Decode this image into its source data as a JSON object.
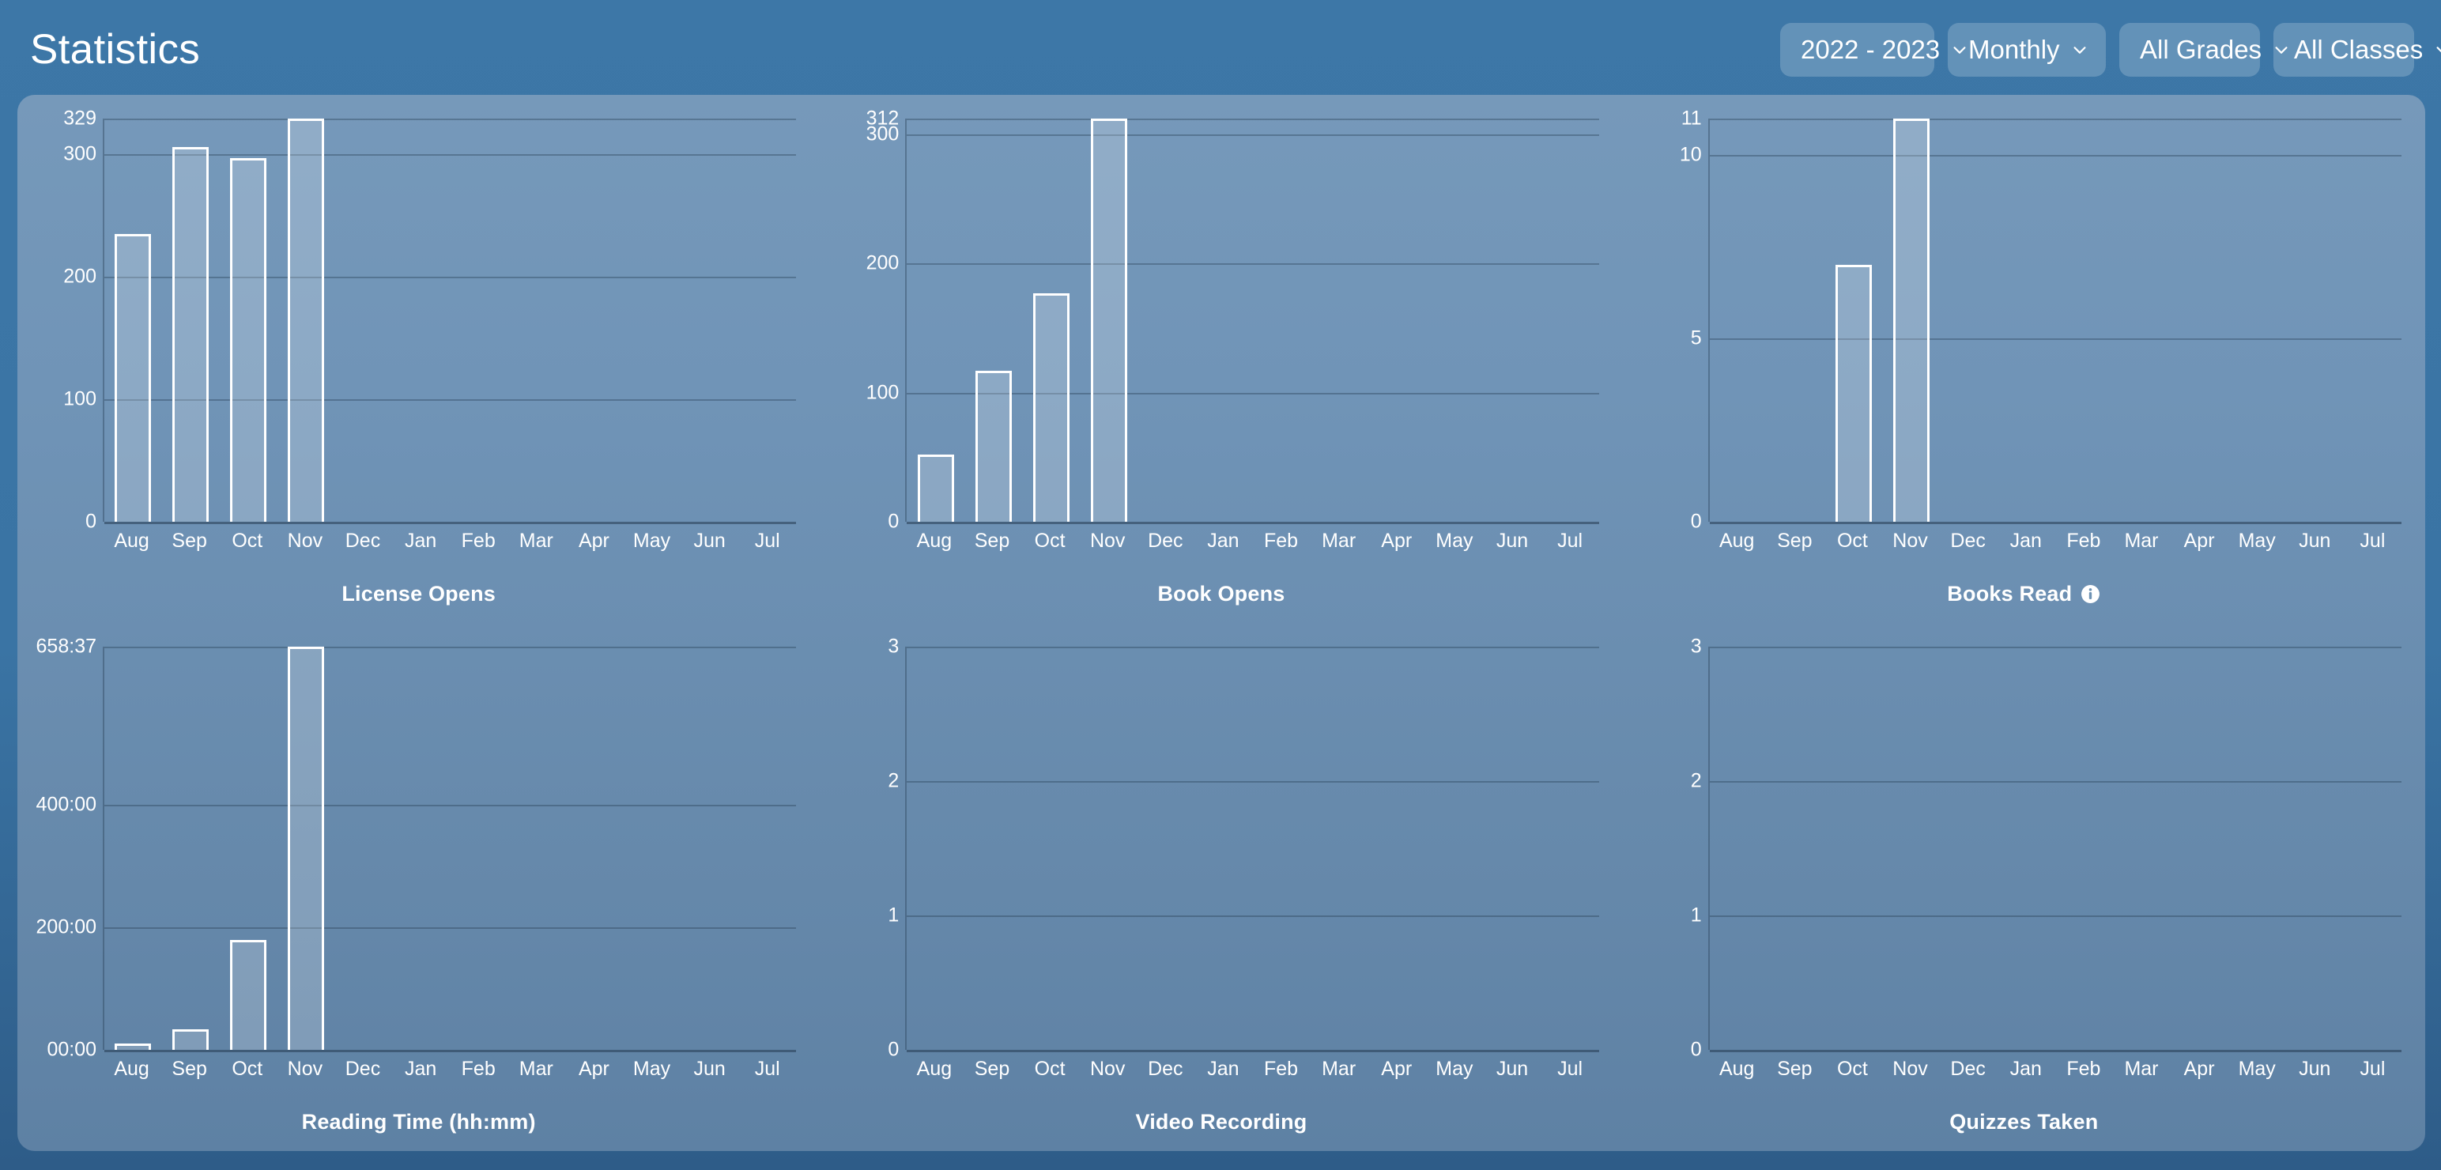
{
  "header": {
    "title": "Statistics",
    "controls": [
      {
        "name": "school-year",
        "label": "2022 - 2023",
        "icon": "chevron-down-icon"
      },
      {
        "name": "period",
        "label": "Monthly",
        "icon": "chevron-down-icon"
      },
      {
        "name": "grades",
        "label": "All Grades",
        "icon": "chevron-down-icon"
      },
      {
        "name": "classes",
        "label": "All Classes",
        "icon": "chevron-down-icon"
      }
    ]
  },
  "colors": {
    "page_background": "#3a74a4",
    "panel_background": "#6e92b4",
    "accent_text": "#ffffff",
    "bar_stroke": "#ffffff",
    "bar_fill": "#80a2c2",
    "gridline": "#3e5c78"
  },
  "months": [
    "Aug",
    "Sep",
    "Oct",
    "Nov",
    "Dec",
    "Jan",
    "Feb",
    "Mar",
    "Apr",
    "May",
    "Jun",
    "Jul"
  ],
  "chart_data": [
    {
      "type": "bar",
      "title": "License Opens",
      "has_info_icon": false,
      "xlabel": "",
      "ylabel": "",
      "categories": [
        "Aug",
        "Sep",
        "Oct",
        "Nov",
        "Dec",
        "Jan",
        "Feb",
        "Mar",
        "Apr",
        "May",
        "Jun",
        "Jul"
      ],
      "values": [
        235,
        306,
        297,
        329,
        0,
        0,
        0,
        0,
        0,
        0,
        0,
        0
      ],
      "ylim": [
        0,
        329
      ],
      "yticks": [
        0,
        100,
        200,
        300,
        329
      ],
      "ytick_labels": [
        "0",
        "100",
        "200",
        "300",
        "329"
      ],
      "grid": true
    },
    {
      "type": "bar",
      "title": "Book Opens",
      "has_info_icon": false,
      "xlabel": "",
      "ylabel": "",
      "categories": [
        "Aug",
        "Sep",
        "Oct",
        "Nov",
        "Dec",
        "Jan",
        "Feb",
        "Mar",
        "Apr",
        "May",
        "Jun",
        "Jul"
      ],
      "values": [
        52,
        117,
        177,
        312,
        0,
        0,
        0,
        0,
        0,
        0,
        0,
        0
      ],
      "ylim": [
        0,
        312
      ],
      "yticks": [
        0,
        100,
        200,
        300,
        312
      ],
      "ytick_labels": [
        "0",
        "100",
        "200",
        "300",
        "312"
      ],
      "grid": true
    },
    {
      "type": "bar",
      "title": "Books Read",
      "has_info_icon": true,
      "info_icon_name": "info-icon",
      "xlabel": "",
      "ylabel": "",
      "categories": [
        "Aug",
        "Sep",
        "Oct",
        "Nov",
        "Dec",
        "Jan",
        "Feb",
        "Mar",
        "Apr",
        "May",
        "Jun",
        "Jul"
      ],
      "values": [
        0,
        0,
        7,
        11,
        0,
        0,
        0,
        0,
        0,
        0,
        0,
        0
      ],
      "ylim": [
        0,
        11
      ],
      "yticks": [
        0,
        5,
        10,
        11
      ],
      "ytick_labels": [
        "0",
        "5",
        "10",
        "11"
      ],
      "grid": true
    },
    {
      "type": "bar",
      "title": "Reading Time (hh:mm)",
      "has_info_icon": false,
      "xlabel": "",
      "ylabel": "",
      "categories": [
        "Aug",
        "Sep",
        "Oct",
        "Nov",
        "Dec",
        "Jan",
        "Feb",
        "Mar",
        "Apr",
        "May",
        "Jun",
        "Jul"
      ],
      "values": [
        10,
        33,
        180,
        658.62,
        0,
        0,
        0,
        0,
        0,
        0,
        0,
        0
      ],
      "value_labels": [
        "10:00",
        "33:00",
        "180:00",
        "658:37",
        "",
        "",
        "",
        "",
        "",
        "",
        "",
        ""
      ],
      "ylim": [
        0,
        658.62
      ],
      "yticks": [
        0,
        200,
        400,
        658.62
      ],
      "ytick_labels": [
        "00:00",
        "200:00",
        "400:00",
        "658:37"
      ],
      "grid": true
    },
    {
      "type": "bar",
      "title": "Video Recording",
      "has_info_icon": false,
      "xlabel": "",
      "ylabel": "",
      "categories": [
        "Aug",
        "Sep",
        "Oct",
        "Nov",
        "Dec",
        "Jan",
        "Feb",
        "Mar",
        "Apr",
        "May",
        "Jun",
        "Jul"
      ],
      "values": [
        0,
        0,
        0,
        0,
        0,
        0,
        0,
        0,
        0,
        0,
        0,
        0
      ],
      "ylim": [
        0,
        3
      ],
      "yticks": [
        0,
        1,
        2,
        3
      ],
      "ytick_labels": [
        "0",
        "1",
        "2",
        "3"
      ],
      "grid": true
    },
    {
      "type": "bar",
      "title": "Quizzes Taken",
      "has_info_icon": false,
      "xlabel": "",
      "ylabel": "",
      "categories": [
        "Aug",
        "Sep",
        "Oct",
        "Nov",
        "Dec",
        "Jan",
        "Feb",
        "Mar",
        "Apr",
        "May",
        "Jun",
        "Jul"
      ],
      "values": [
        0,
        0,
        0,
        0,
        0,
        0,
        0,
        0,
        0,
        0,
        0,
        0
      ],
      "ylim": [
        0,
        3
      ],
      "yticks": [
        0,
        1,
        2,
        3
      ],
      "ytick_labels": [
        "0",
        "1",
        "2",
        "3"
      ],
      "grid": true
    }
  ]
}
